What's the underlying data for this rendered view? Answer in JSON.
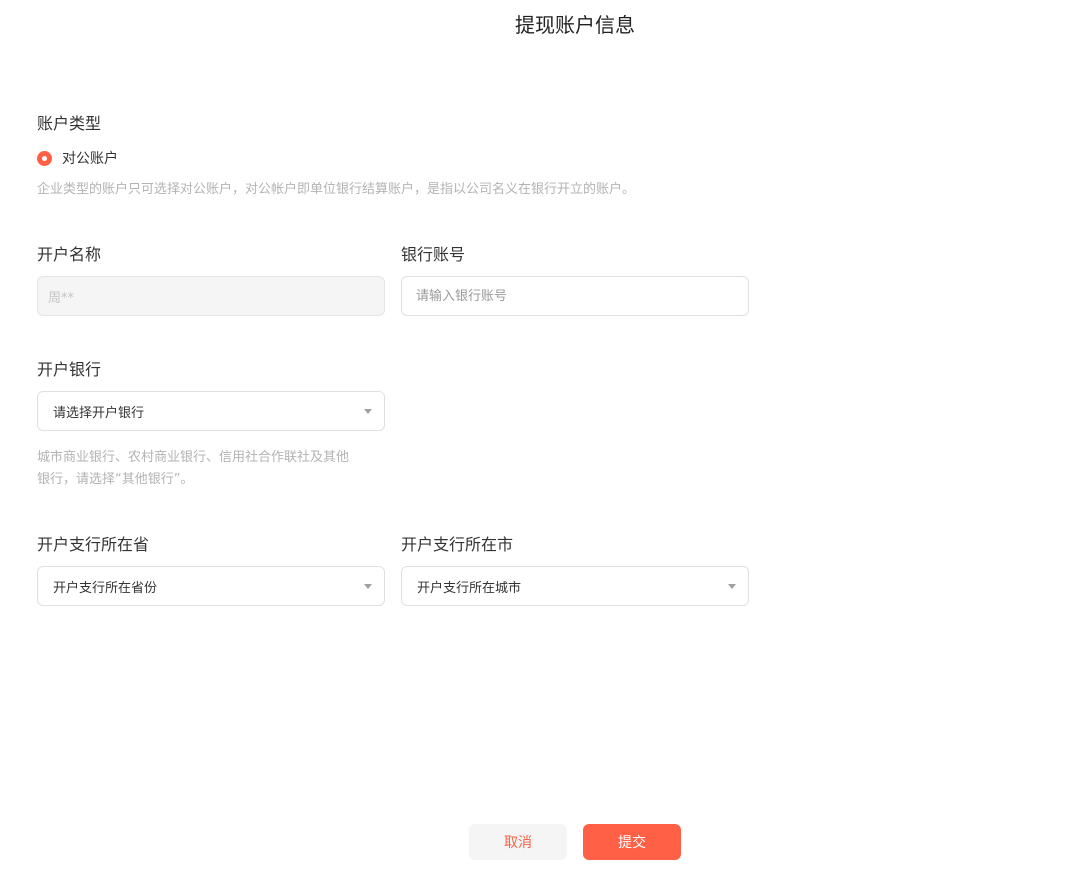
{
  "page": {
    "title": "提现账户信息"
  },
  "account_type": {
    "label": "账户类型",
    "option_label": "对公账户",
    "selected": true,
    "hint": "企业类型的账户只可选择对公账户，对公帐户即单位银行结算账户，是指以公司名义在银行开立的账户。"
  },
  "account_name": {
    "label": "开户名称",
    "value": "周**",
    "disabled": true
  },
  "bank_account": {
    "label": "银行账号",
    "value": "",
    "placeholder": "请输入银行账号"
  },
  "bank": {
    "label": "开户银行",
    "selected_text": "请选择开户银行",
    "hint_line1": "城市商业银行、农村商业银行、信用社合作联社及其他",
    "hint_line2": "银行，请选择“其他银行”。"
  },
  "province": {
    "label": "开户支行所在省",
    "selected_text": "开户支行所在省份"
  },
  "city": {
    "label": "开户支行所在市",
    "selected_text": "开户支行所在城市"
  },
  "actions": {
    "cancel_label": "取消",
    "submit_label": "提交"
  },
  "colors": {
    "accent": "#ff6046",
    "hint_text": "#b3b3b3",
    "border": "#e0e0e0",
    "disabled_bg": "#f5f5f5"
  },
  "icons": {
    "radio": "radio-checked-icon",
    "dropdown": "caret-down-icon"
  }
}
